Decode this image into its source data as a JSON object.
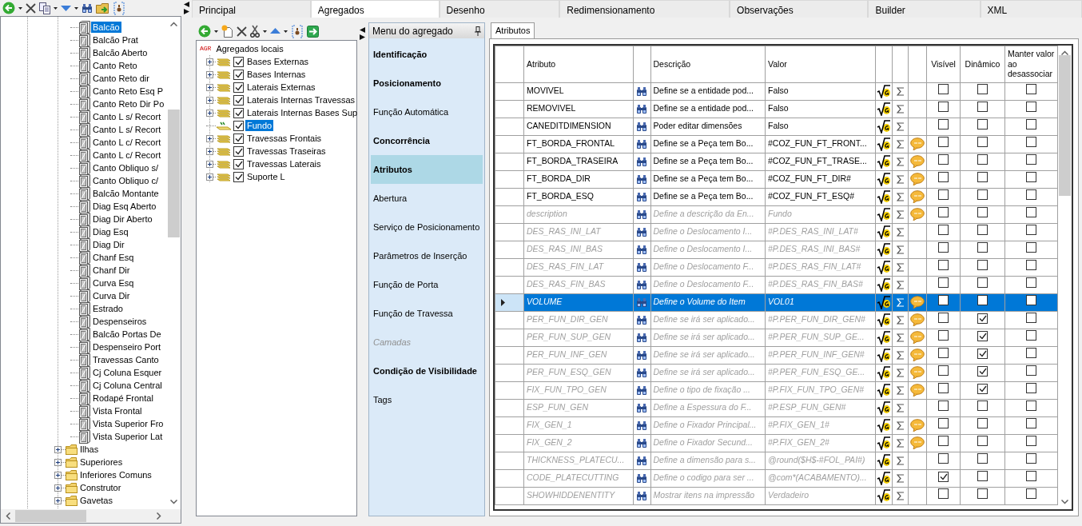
{
  "left_tree": {
    "nodes": [
      {
        "children": [
          {
            "label": "Balcão",
            "selected": true
          },
          {
            "label": "Balcão Prat",
            "selected": false
          },
          {
            "label": "Balcão Aberto",
            "selected": false
          },
          {
            "label": "Canto Reto",
            "selected": false
          },
          {
            "label": "Canto Reto dir",
            "selected": false
          },
          {
            "label": "Canto Reto Esq P",
            "selected": false
          },
          {
            "label": "Canto Reto Dir Po",
            "selected": false
          },
          {
            "label": "Canto L s/ Recort",
            "selected": false
          },
          {
            "label": "Canto L s/ Recort",
            "selected": false
          },
          {
            "label": "Canto L c/ Recort",
            "selected": false
          },
          {
            "label": "Canto L c/ Recort",
            "selected": false
          },
          {
            "label": "Canto Obliquo s/",
            "selected": false
          },
          {
            "label": "Canto Obliquo c/",
            "selected": false
          },
          {
            "label": "Balcão Montante",
            "selected": false
          },
          {
            "label": "Diag Esq Aberto",
            "selected": false
          },
          {
            "label": "Diag Dir Aberto",
            "selected": false
          },
          {
            "label": "Diag Esq",
            "selected": false
          },
          {
            "label": "Diag Dir",
            "selected": false
          },
          {
            "label": "Chanf Esq",
            "selected": false
          },
          {
            "label": "Chanf Dir",
            "selected": false
          },
          {
            "label": "Curva Esq",
            "selected": false
          },
          {
            "label": "Curva Dir",
            "selected": false
          },
          {
            "label": "Estrado",
            "selected": false
          },
          {
            "label": "Despenseiros",
            "selected": false
          },
          {
            "label": "Balcão Portas De",
            "selected": false
          },
          {
            "label": "Despenseiro Port",
            "selected": false
          },
          {
            "label": "Travessas Canto",
            "selected": false
          },
          {
            "label": "Cj Coluna Esquer",
            "selected": false
          },
          {
            "label": "Cj Coluna Central",
            "selected": false
          },
          {
            "label": "Rodapé Frontal",
            "selected": false
          },
          {
            "label": "Vista Frontal",
            "selected": false
          },
          {
            "label": "Vista Superior Fro",
            "selected": false
          },
          {
            "label": "Vista Superior Lat",
            "selected": false
          }
        ]
      },
      {
        "label": "Ilhas",
        "expanded": false,
        "selected": false
      },
      {
        "label": "Superiores",
        "expanded": false,
        "selected": false
      },
      {
        "label": "Inferiores Comuns",
        "expanded": false,
        "selected": false
      },
      {
        "label": "Construtor",
        "expanded": false,
        "selected": false
      },
      {
        "label": "Gavetas",
        "expanded": false,
        "selected": false
      }
    ]
  },
  "tabs": [
    {
      "label": "Principal",
      "selected": false
    },
    {
      "label": "Agregados",
      "selected": true
    },
    {
      "label": "Desenho",
      "selected": false
    },
    {
      "label": "Redimensionamento",
      "selected": false
    },
    {
      "label": "Observações",
      "selected": false
    },
    {
      "label": "Builder",
      "selected": false
    },
    {
      "label": "XML",
      "selected": false
    }
  ],
  "aggregate_tree": {
    "root": {
      "badge": "AGR",
      "label": "Agregados locais"
    },
    "children": [
      {
        "label": "Bases Externas",
        "checked": true,
        "expandable": true,
        "selected": false
      },
      {
        "label": "Bases Internas",
        "checked": true,
        "expandable": true,
        "selected": false
      },
      {
        "label": "Laterais Externas",
        "checked": true,
        "expandable": true,
        "selected": false
      },
      {
        "label": "Laterais Internas Travessas",
        "checked": true,
        "expandable": true,
        "selected": false
      },
      {
        "label": "Laterais Internas Bases Sup",
        "checked": true,
        "expandable": true,
        "selected": false
      },
      {
        "label": "Fundo",
        "checked": true,
        "expandable": false,
        "selected": true
      },
      {
        "label": "Travessas Frontais",
        "checked": true,
        "expandable": true,
        "selected": false
      },
      {
        "label": "Travessas Traseiras",
        "checked": true,
        "expandable": true,
        "selected": false
      },
      {
        "label": "Travessas Laterais",
        "checked": true,
        "expandable": true,
        "selected": false
      },
      {
        "label": "Suporte L",
        "checked": true,
        "expandable": true,
        "selected": false
      }
    ]
  },
  "menu": {
    "title": "Menu do agregado",
    "items": [
      {
        "label": "Identificação",
        "bold": true,
        "disabled": false,
        "selected": false
      },
      {
        "label": "Posicionamento",
        "bold": true,
        "disabled": false,
        "selected": false
      },
      {
        "label": "Função Automática",
        "bold": false,
        "disabled": false,
        "selected": false
      },
      {
        "label": "Concorrência",
        "bold": true,
        "disabled": false,
        "selected": false
      },
      {
        "label": "Atributos",
        "bold": true,
        "disabled": false,
        "selected": true
      },
      {
        "label": "Abertura",
        "bold": false,
        "disabled": false,
        "selected": false
      },
      {
        "label": "Serviço de Posicionamento",
        "bold": false,
        "disabled": false,
        "selected": false
      },
      {
        "label": "Parâmetros de Inserção",
        "bold": false,
        "disabled": false,
        "selected": false
      },
      {
        "label": "Função de Porta",
        "bold": false,
        "disabled": false,
        "selected": false
      },
      {
        "label": "Função de Travessa",
        "bold": false,
        "disabled": false,
        "selected": false
      },
      {
        "label": "Camadas",
        "bold": false,
        "disabled": true,
        "selected": false
      },
      {
        "label": "Condição de Visibilidade",
        "bold": true,
        "disabled": false,
        "selected": false
      },
      {
        "label": "Tags",
        "bold": false,
        "disabled": false,
        "selected": false
      }
    ]
  },
  "attributes": {
    "tab": "Atributos",
    "columns": [
      "Atributo",
      "Descrição",
      "Valor",
      "Visível",
      "Dinâmico",
      "Manter valor ao desassociar"
    ],
    "rows": [
      {
        "attribute": "MOVIVEL",
        "description": "Define se a entidade pod...",
        "value": "Falso",
        "inherited": false,
        "comment": false,
        "visible": false,
        "dynamic": false,
        "keep": false,
        "selected": false
      },
      {
        "attribute": "REMOVIVEL",
        "description": "Define se a entidade pod...",
        "value": "Falso",
        "inherited": false,
        "comment": false,
        "visible": false,
        "dynamic": false,
        "keep": false,
        "selected": false
      },
      {
        "attribute": "CANEDITDIMENSION",
        "description": "Poder editar dimensões",
        "value": "Falso",
        "inherited": false,
        "comment": false,
        "visible": false,
        "dynamic": false,
        "keep": false,
        "selected": false
      },
      {
        "attribute": "FT_BORDA_FRONTAL",
        "description": "Define se a Peça tem Bo...",
        "value": "#COZ_FUN_FT_FRONT...",
        "inherited": false,
        "comment": true,
        "visible": false,
        "dynamic": false,
        "keep": false,
        "selected": false
      },
      {
        "attribute": "FT_BORDA_TRASEIRA",
        "description": "Define se a Peça tem Bo...",
        "value": "#COZ_FUN_FT_TRASE...",
        "inherited": false,
        "comment": true,
        "visible": false,
        "dynamic": false,
        "keep": false,
        "selected": false
      },
      {
        "attribute": "FT_BORDA_DIR",
        "description": "Define se a Peça tem Bo...",
        "value": "#COZ_FUN_FT_DIR#",
        "inherited": false,
        "comment": true,
        "visible": false,
        "dynamic": false,
        "keep": false,
        "selected": false
      },
      {
        "attribute": "FT_BORDA_ESQ",
        "description": "Define se a Peça tem Bo...",
        "value": "#COZ_FUN_FT_ESQ#",
        "inherited": false,
        "comment": true,
        "visible": false,
        "dynamic": false,
        "keep": false,
        "selected": false
      },
      {
        "attribute": "description",
        "description": "Define a descrição da En...",
        "value": "Fundo",
        "inherited": true,
        "comment": true,
        "visible": false,
        "dynamic": false,
        "keep": false,
        "selected": false
      },
      {
        "attribute": "DES_RAS_INI_LAT",
        "description": "Define o Deslocamento I...",
        "value": "#P.DES_RAS_INI_LAT#",
        "inherited": true,
        "comment": false,
        "visible": false,
        "dynamic": false,
        "keep": false,
        "selected": false
      },
      {
        "attribute": "DES_RAS_INI_BAS",
        "description": "Define o Deslocamento I...",
        "value": "#P.DES_RAS_INI_BAS#",
        "inherited": true,
        "comment": false,
        "visible": false,
        "dynamic": false,
        "keep": false,
        "selected": false
      },
      {
        "attribute": "DES_RAS_FIN_LAT",
        "description": "Define o Deslocamento F...",
        "value": "#P.DES_RAS_FIN_LAT#",
        "inherited": true,
        "comment": false,
        "visible": false,
        "dynamic": false,
        "keep": false,
        "selected": false
      },
      {
        "attribute": "DES_RAS_FIN_BAS",
        "description": "Define o Deslocamento F...",
        "value": "#P.DES_RAS_FIN_BAS#",
        "inherited": true,
        "comment": false,
        "visible": false,
        "dynamic": false,
        "keep": false,
        "selected": false
      },
      {
        "attribute": "VOLUME",
        "description": "Define o Volume do Item",
        "value": "VOL01",
        "inherited": true,
        "comment": true,
        "visible": false,
        "dynamic": false,
        "keep": false,
        "selected": true
      },
      {
        "attribute": "PER_FUN_DIR_GEN",
        "description": "Define se irá ser aplicado...",
        "value": "#P.PER_FUN_DIR_GEN#",
        "inherited": true,
        "comment": true,
        "visible": false,
        "dynamic": true,
        "keep": false,
        "selected": false
      },
      {
        "attribute": "PER_FUN_SUP_GEN",
        "description": "Define se irá ser aplicado...",
        "value": "#P.PER_FUN_SUP_GE...",
        "inherited": true,
        "comment": true,
        "visible": false,
        "dynamic": true,
        "keep": false,
        "selected": false
      },
      {
        "attribute": "PER_FUN_INF_GEN",
        "description": "Define se irá ser aplicado...",
        "value": "#P.PER_FUN_INF_GEN#",
        "inherited": true,
        "comment": true,
        "visible": false,
        "dynamic": true,
        "keep": false,
        "selected": false
      },
      {
        "attribute": "PER_FUN_ESQ_GEN",
        "description": "Define se irá ser aplicado...",
        "value": "#P.PER_FUN_ESQ_GE...",
        "inherited": true,
        "comment": true,
        "visible": false,
        "dynamic": true,
        "keep": false,
        "selected": false
      },
      {
        "attribute": "FIX_FUN_TPO_GEN",
        "description": "Define o tipo de fixação ...",
        "value": "#P.FIX_FUN_TPO_GEN#",
        "inherited": true,
        "comment": true,
        "visible": false,
        "dynamic": true,
        "keep": false,
        "selected": false
      },
      {
        "attribute": "ESP_FUN_GEN",
        "description": "Define a Espessura do F...",
        "value": "#P.ESP_FUN_GEN#",
        "inherited": true,
        "comment": false,
        "visible": false,
        "dynamic": false,
        "keep": false,
        "selected": false
      },
      {
        "attribute": "FIX_GEN_1",
        "description": "Define o Fixador Principal...",
        "value": "#P.FIX_GEN_1#",
        "inherited": true,
        "comment": true,
        "visible": false,
        "dynamic": false,
        "keep": false,
        "selected": false
      },
      {
        "attribute": "FIX_GEN_2",
        "description": "Define o Fixador Secund...",
        "value": "#P.FIX_GEN_2#",
        "inherited": true,
        "comment": true,
        "visible": false,
        "dynamic": false,
        "keep": false,
        "selected": false
      },
      {
        "attribute": "THICKNESS_PLATECU...",
        "description": "Define a dimensão para s...",
        "value": "@round($H$-#FOL_PAI#)",
        "inherited": true,
        "comment": false,
        "visible": false,
        "dynamic": false,
        "keep": false,
        "selected": false
      },
      {
        "attribute": "CODE_PLATECUTTING",
        "description": "Define o codigo para ser ...",
        "value": "@com*(ACABAMENTO)...",
        "inherited": true,
        "comment": false,
        "visible": true,
        "dynamic": false,
        "keep": false,
        "selected": false
      },
      {
        "attribute": "SHOWHIDDENENTITY",
        "description": "Mostrar itens na impressão",
        "value": "Verdadeiro",
        "inherited": true,
        "comment": false,
        "visible": false,
        "dynamic": false,
        "keep": false,
        "selected": false
      }
    ]
  }
}
